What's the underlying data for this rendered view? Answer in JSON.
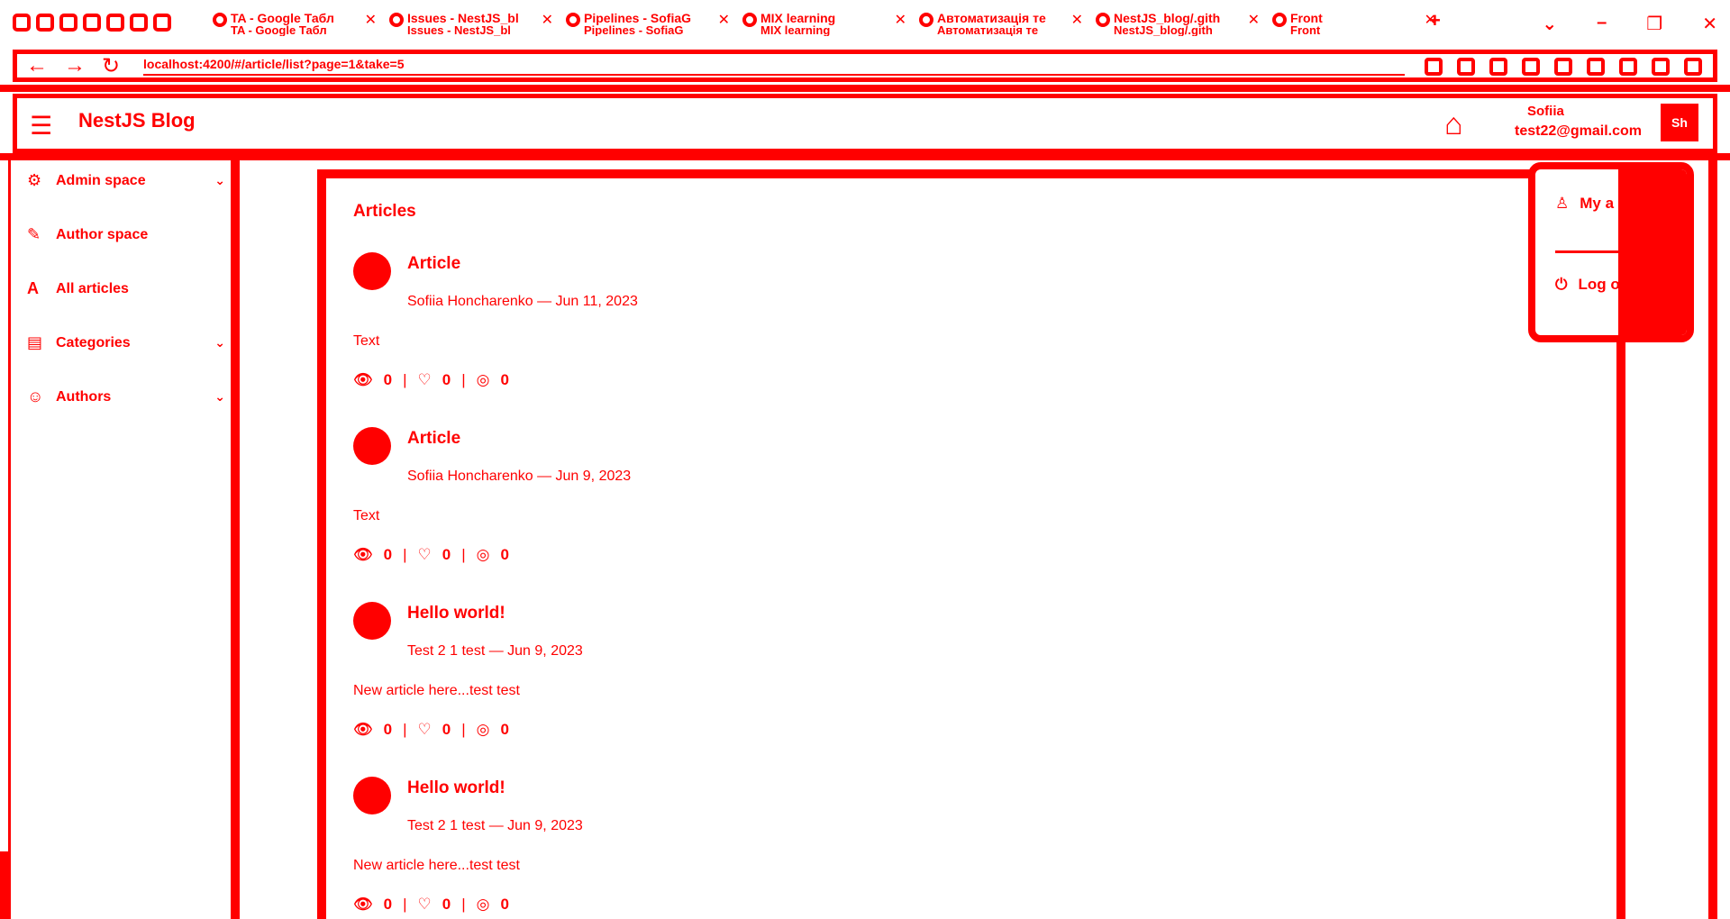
{
  "browser": {
    "tabs": [
      {
        "label": "TA - Google Табл",
        "sub": "TA - Google Табл"
      },
      {
        "label": "Issues - NestJS_bl",
        "sub": "Issues - NestJS_bl"
      },
      {
        "label": "Pipelines - SofiaG",
        "sub": "Pipelines - SofiaG"
      },
      {
        "label": "MIX learning",
        "sub": "MIX learning"
      },
      {
        "label": "Автоматизація те",
        "sub": "Автоматизація те"
      },
      {
        "label": "NestJS_blog/.gith",
        "sub": "NestJS_blog/.gith"
      },
      {
        "label": "Front",
        "sub": "Front"
      }
    ],
    "url": "localhost:4200/#/article/list?page=1&take=5"
  },
  "header": {
    "title": "NestJS Blog",
    "user_name": "Sofiia",
    "user_email": "test22@gmail.com",
    "avatar_text": "Sh"
  },
  "sidebar": {
    "items": [
      {
        "label": "Admin space",
        "icon": "gear-icon",
        "has_chevron": true
      },
      {
        "label": "Author space",
        "icon": "pen-icon",
        "has_chevron": false
      },
      {
        "label": "All articles",
        "icon": "text-icon",
        "has_chevron": false
      },
      {
        "label": "Categories",
        "icon": "category-icon",
        "has_chevron": true
      },
      {
        "label": "Authors",
        "icon": "people-icon",
        "has_chevron": true
      }
    ]
  },
  "main": {
    "heading": "Articles",
    "articles": [
      {
        "title": "Article",
        "meta": "Sofiia Honcharenko — Jun 11, 2023",
        "text": "Text",
        "views": "0",
        "likes": "0",
        "comments": "0"
      },
      {
        "title": "Article",
        "meta": "Sofiia Honcharenko — Jun 9, 2023",
        "text": "Text",
        "views": "0",
        "likes": "0",
        "comments": "0"
      },
      {
        "title": "Hello world!",
        "meta": "Test 2 1 test — Jun 9, 2023",
        "text": "New article here...test test",
        "views": "0",
        "likes": "0",
        "comments": "0"
      },
      {
        "title": "Hello world!",
        "meta": "Test 2 1 test — Jun 9, 2023",
        "text": "New article here...test test",
        "views": "0",
        "likes": "0",
        "comments": "0"
      }
    ]
  },
  "user_menu": {
    "my_account": "My a",
    "logout": "Log o"
  },
  "colors": {
    "accent": "#ff0000"
  }
}
